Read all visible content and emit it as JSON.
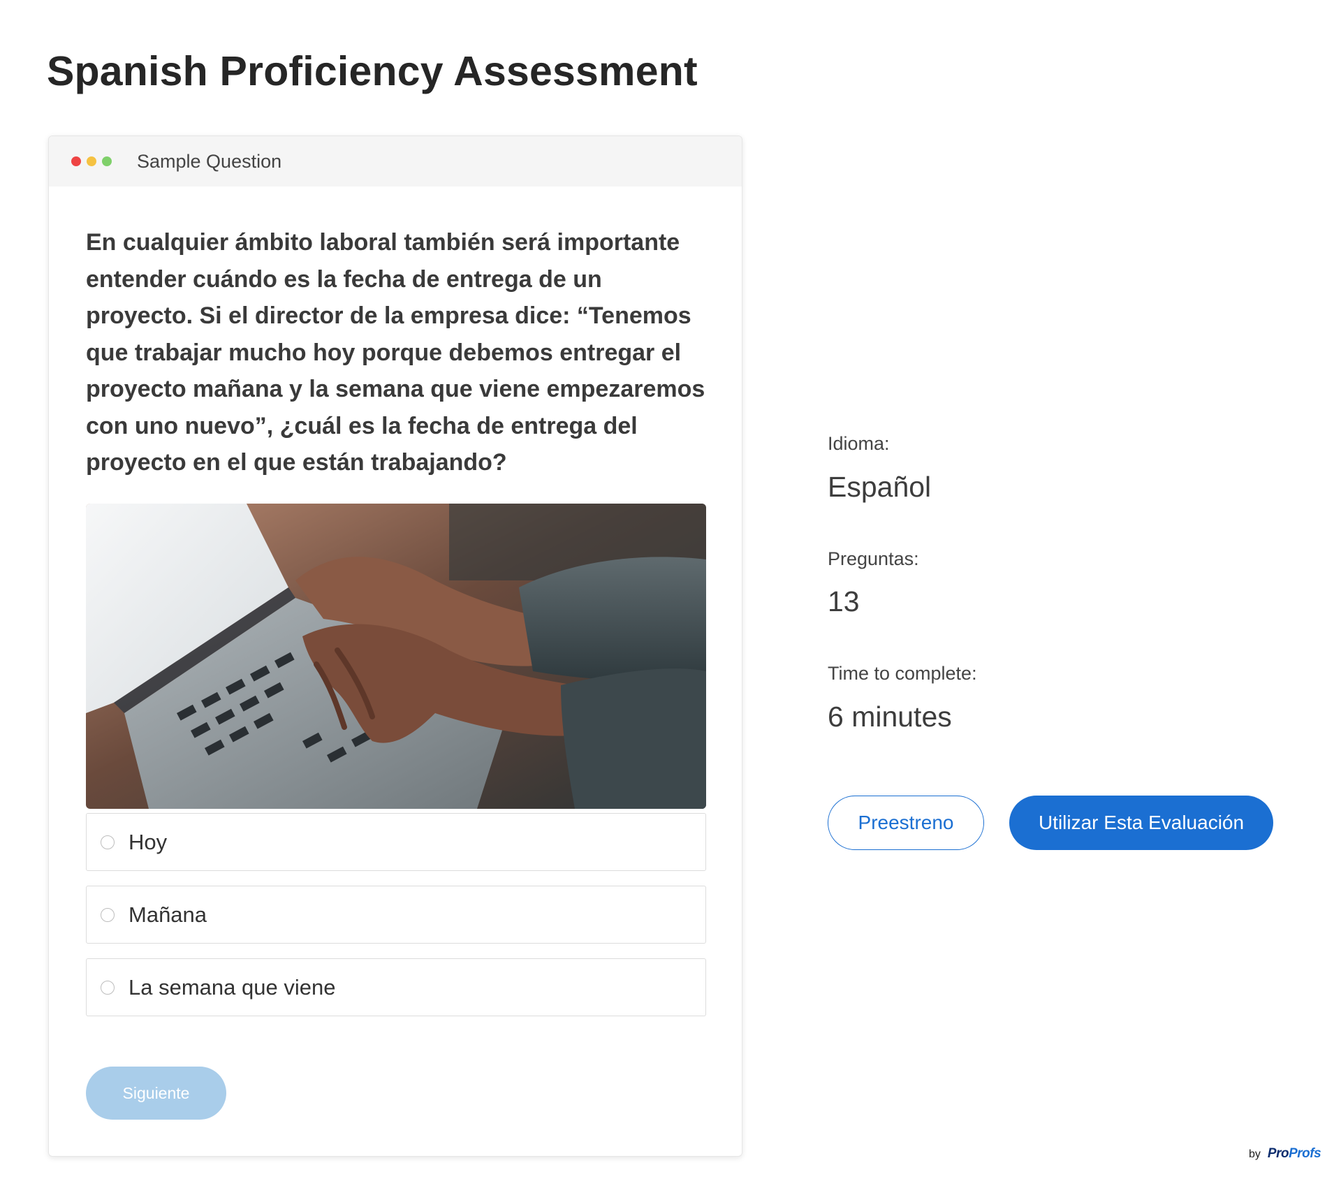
{
  "page": {
    "title": "Spanish Proficiency Assessment"
  },
  "card": {
    "header_title": "Sample Question",
    "window_dot_colors": [
      "#ee4444",
      "#f5c242",
      "#7fd06a"
    ],
    "question": "En cualquier ámbito laboral también será importante entender cuándo es la fecha de entrega de un proyecto. Si el director de la empresa dice: “Tenemos que trabajar mucho hoy porque debemos entregar el proyecto mañana y la semana que viene empezaremos con uno nuevo”, ¿cuál es la fecha de entrega del proyecto en el que están trabajando?",
    "image_subject": "hands-typing-on-laptop",
    "options": [
      {
        "label": "Hoy",
        "selected": false
      },
      {
        "label": "Mañana",
        "selected": false
      },
      {
        "label": "La semana que viene",
        "selected": false
      }
    ],
    "next_button_label": "Siguiente"
  },
  "details": {
    "language_label": "Idioma:",
    "language_value": "Español",
    "questions_label": "Preguntas:",
    "questions_value": "13",
    "time_label": "Time to complete:",
    "time_value": "6 minutes"
  },
  "actions": {
    "preview_label": "Preestreno",
    "use_label": "Utilizar Esta Evaluación"
  },
  "footer": {
    "by": "by",
    "brand_part1": "Pro",
    "brand_part2": "Profs"
  },
  "colors": {
    "accent": "#1b6fd2",
    "disabled_button": "#a9cdea"
  }
}
